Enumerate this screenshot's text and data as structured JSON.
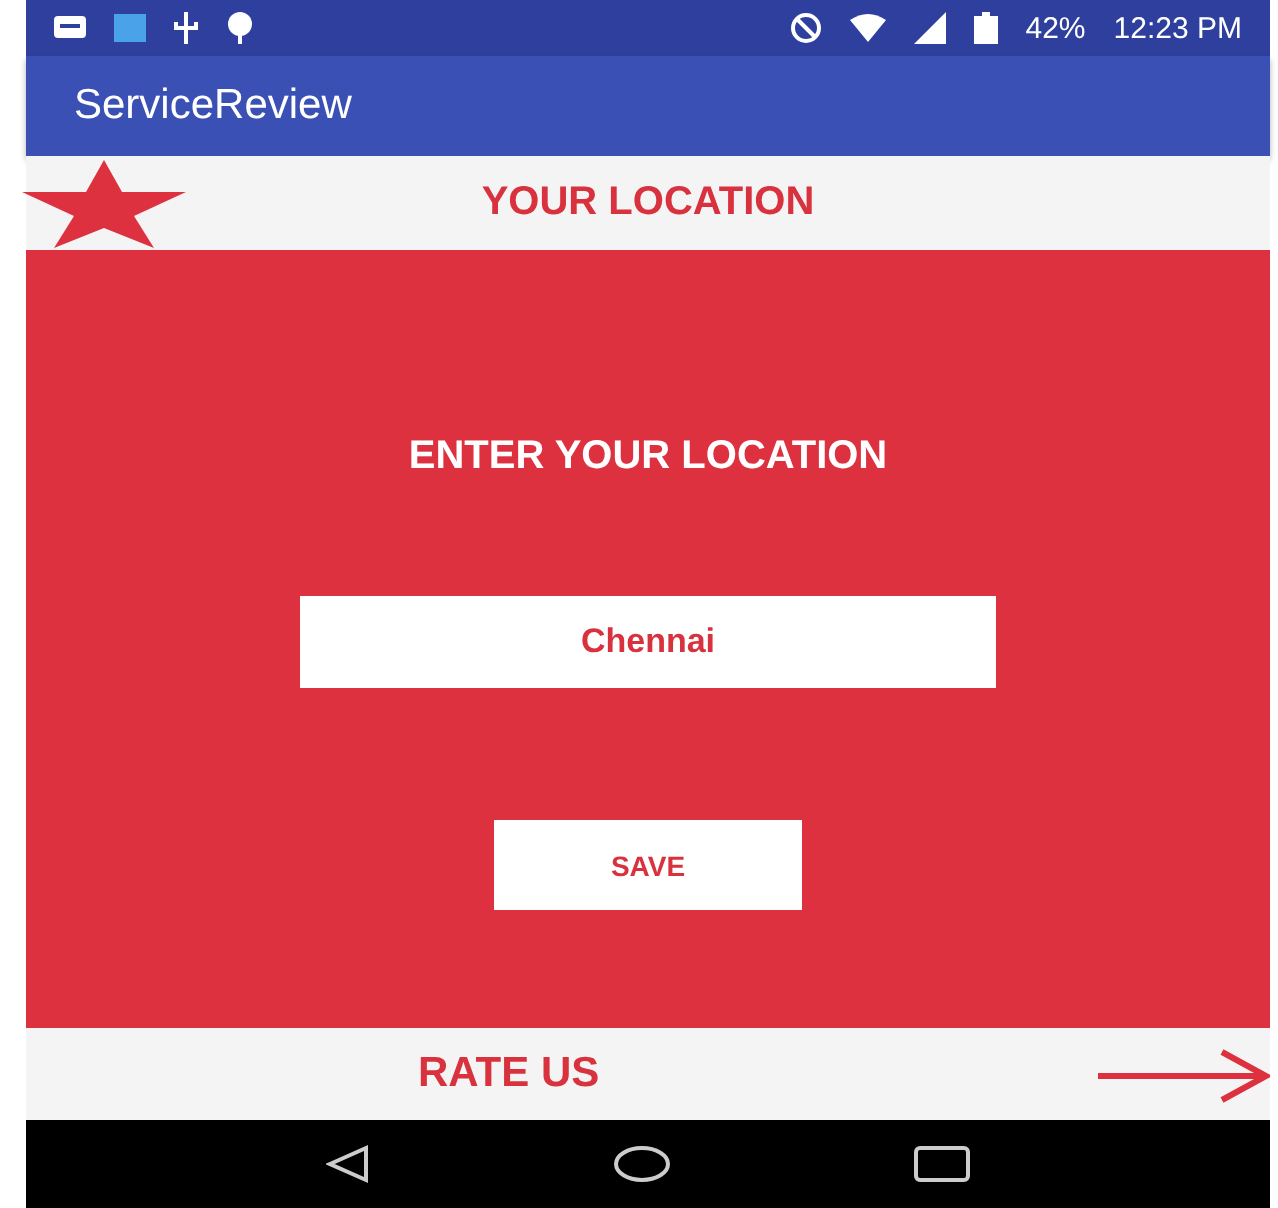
{
  "status_bar": {
    "battery": "42%",
    "time": "12:23 PM"
  },
  "app_bar": {
    "title": "ServiceReview"
  },
  "header": {
    "title": "YOUR LOCATION"
  },
  "form": {
    "prompt": "ENTER YOUR LOCATION",
    "location": {
      "value": "Chennai"
    },
    "save_button": "SAVE"
  },
  "footer": {
    "label": "RATE US"
  }
}
